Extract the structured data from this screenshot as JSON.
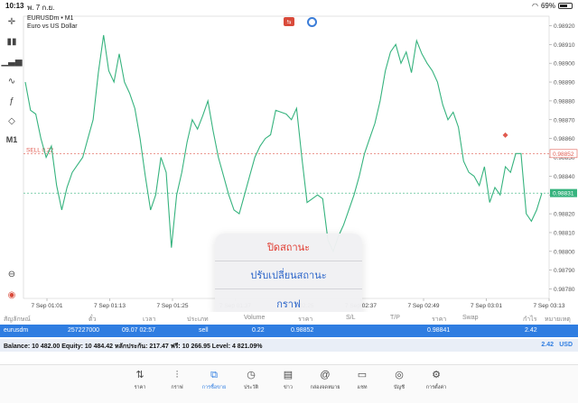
{
  "status": {
    "time": "10:13",
    "date": "พ. 7 ก.ย.",
    "battery": "69%",
    "battery_level": 0.69
  },
  "chart_header": {
    "symbol": "EURUSDm • M1",
    "description": "Euro vs US Dollar"
  },
  "toolbar": {
    "timeframe": "M1"
  },
  "chart_data": {
    "type": "line",
    "ylim": [
      0.98775,
      0.98925
    ],
    "y_ticks": [
      "0.98920",
      "0.98910",
      "0.98900",
      "0.98890",
      "0.98880",
      "0.98870",
      "0.98860",
      "0.98850",
      "0.98840",
      "0.98830",
      "0.98820",
      "0.98810",
      "0.98800",
      "0.98790",
      "0.98780"
    ],
    "x_ticks": [
      "7 Sep 01:01",
      "7 Sep 01:13",
      "7 Sep 01:25",
      "7 Sep 01:37",
      "7 Sep 02:25",
      "7 Sep 02:37",
      "7 Sep 02:49",
      "7 Sep 03:01",
      "7 Sep 03:13"
    ],
    "sell_line": {
      "label": "SELL 0.22",
      "value": 0.98852,
      "value_label": "0.98852"
    },
    "bid_line": {
      "value": 0.98831,
      "value_label": "0.98831"
    },
    "series": [
      {
        "values": [
          0.9889,
          0.98875,
          0.98873,
          0.9886,
          0.9885,
          0.98856,
          0.98835,
          0.98822,
          0.98834,
          0.98842,
          0.98846,
          0.9885,
          0.9886,
          0.9887,
          0.98895,
          0.98915,
          0.98896,
          0.9889,
          0.98905,
          0.9889,
          0.98884,
          0.98876,
          0.9886,
          0.9884,
          0.98822,
          0.9883,
          0.9885,
          0.98842,
          0.98802,
          0.9883,
          0.98842,
          0.98858,
          0.9887,
          0.98865,
          0.98872,
          0.9888,
          0.98864,
          0.9885,
          0.9884,
          0.9883,
          0.98822,
          0.9882,
          0.9883,
          0.9884,
          0.9885,
          0.98856,
          0.9886,
          0.98862,
          0.98875,
          0.98874,
          0.98873,
          0.9887,
          0.98876,
          0.9885,
          0.98826,
          0.98828,
          0.9883,
          0.98828,
          0.98806,
          0.988,
          0.98808,
          0.98814,
          0.98822,
          0.9883,
          0.9884,
          0.98852,
          0.9886,
          0.98868,
          0.9888,
          0.98896,
          0.98906,
          0.9891,
          0.989,
          0.98906,
          0.98895,
          0.98912,
          0.98905,
          0.989,
          0.98896,
          0.9889,
          0.98878,
          0.9887,
          0.98874,
          0.98866,
          0.98848,
          0.98842,
          0.9884,
          0.98835,
          0.98845,
          0.98826,
          0.98834,
          0.9883,
          0.98845,
          0.98842,
          0.98852,
          0.98852,
          0.9882,
          0.98816,
          0.98822,
          0.98831
        ]
      }
    ],
    "sell_marker_index": 92
  },
  "popup": {
    "close": "ปิดสถานะ",
    "modify": "ปรับเปลี่ยนสถานะ",
    "chart": "กราฟ"
  },
  "table": {
    "headers": {
      "symbol": "สัญลักษณ์",
      "ticket": "ตั๋ว",
      "time": "เวลา",
      "type": "ประเภท",
      "volume": "Volume",
      "price": "ราคา",
      "sl": "S/L",
      "tp": "T/P",
      "cur_price": "ราคา",
      "swap": "Swap",
      "profit": "กำไร",
      "comment": "หมายเหตุ"
    },
    "row": {
      "symbol": "eurusdm",
      "ticket": "257227000",
      "time": "09.07 02:57",
      "type": "sell",
      "volume": "0.22",
      "price": "0.98852",
      "cur_price": "0.98841",
      "profit": "2.42"
    }
  },
  "balance": {
    "text": "Balance: 10 482.00 Equity: 10 484.42 หลักประกัน: 217.47 ฟรี: 10 266.95 Level: 4 821.09%",
    "total": "2.42",
    "currency": "USD"
  },
  "tabs": [
    {
      "label": "ราคา",
      "icon": "arrows-updown-icon",
      "active": false
    },
    {
      "label": "กราฟ",
      "icon": "candles-icon",
      "active": false
    },
    {
      "label": "การซื้อขาย",
      "icon": "trade-chart-icon",
      "active": true
    },
    {
      "label": "ประวัติ",
      "icon": "history-clock-icon",
      "active": false
    },
    {
      "label": "ข่าว",
      "icon": "news-icon",
      "active": false
    },
    {
      "label": "กล่องจดหมาย",
      "icon": "mail-at-icon",
      "active": false
    },
    {
      "label": "แชท",
      "icon": "chat-bubble-icon",
      "active": false
    },
    {
      "label": "บัญชี",
      "icon": "account-icon",
      "active": false
    },
    {
      "label": "การตั้งค่า",
      "icon": "settings-gear-icon",
      "active": false
    }
  ],
  "colors": {
    "line": "#36b37e",
    "sell": "#e05a4f",
    "accent": "#2f7de1"
  }
}
